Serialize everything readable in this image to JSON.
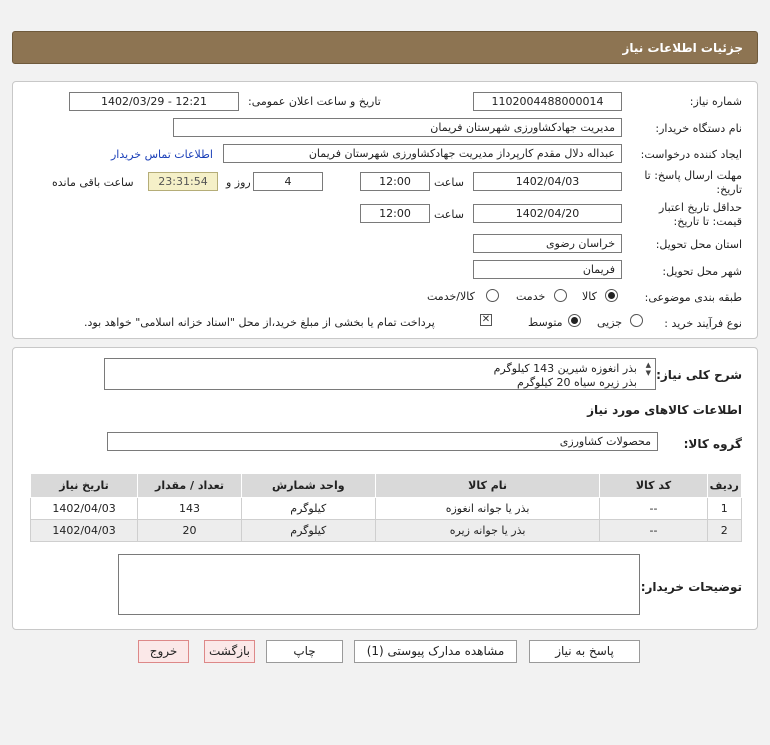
{
  "header": {
    "title": "جزئیات اطلاعات نیاز"
  },
  "form": {
    "need_number": {
      "label": "شماره نیاز:",
      "value": "1102004488000014"
    },
    "announce": {
      "label": "تاریخ و ساعت اعلان عمومی:",
      "value": "1402/03/29 - 12:21"
    },
    "buyer_org": {
      "label": "نام دستگاه خریدار:",
      "value": "مدیریت جهادکشاورزی شهرستان فریمان"
    },
    "creator": {
      "label": "ایجاد کننده درخواست:",
      "value": "عبداله دلال مقدم کارپرداز مدیریت جهادکشاورزی شهرستان فریمان"
    },
    "contact_link": "اطلاعات تماس خریدار",
    "reply_deadline": {
      "label_line1": "مهلت ارسال پاسخ: تا",
      "label_line2": "تاریخ:",
      "date": "1402/04/03",
      "time_label": "ساعت",
      "time": "12:00",
      "days": "4",
      "days_label": "روز و",
      "remaining": "23:31:54",
      "remaining_label": "ساعت باقی مانده"
    },
    "price_validity": {
      "label_line1": "حداقل تاریخ اعتبار",
      "label_line2": "قیمت: تا تاریخ:",
      "date": "1402/04/20",
      "time_label": "ساعت",
      "time": "12:00"
    },
    "province": {
      "label": "استان محل تحویل:",
      "value": "خراسان رضوی"
    },
    "city": {
      "label": "شهر محل تحویل:",
      "value": "فریمان"
    },
    "category": {
      "label": "طبقه بندی موضوعی:",
      "options": [
        "کالا",
        "خدمت",
        "کالا/خدمت"
      ],
      "selected": "کالا"
    },
    "process": {
      "label": "نوع فرآیند خرید :",
      "options": [
        "جزیی",
        "متوسط"
      ],
      "selected": "متوسط",
      "note": "پرداخت تمام یا بخشی از مبلغ خرید،از محل \"اسناد خزانه اسلامی\" خواهد بود."
    }
  },
  "summary": {
    "label": "شرح کلی نیاز:",
    "line1": "بذر انغوزه شیرین 143 کیلوگرم",
    "line2": "بذر زیره سیاه 20 کیلوگرم"
  },
  "goods_section_title": "اطلاعات کالاهای مورد نیاز",
  "goods_group": {
    "label": "گروه کالا:",
    "value": "محصولات کشاورزی"
  },
  "table": {
    "headers": [
      "ردیف",
      "کد کالا",
      "نام کالا",
      "واحد شمارش",
      "تعداد / مقدار",
      "تاریخ نیاز"
    ],
    "rows": [
      [
        "1",
        "--",
        "بذر یا جوانه انغوزه",
        "کیلوگرم",
        "143",
        "1402/04/03"
      ],
      [
        "2",
        "--",
        "بذر یا جوانه زیره",
        "کیلوگرم",
        "20",
        "1402/04/03"
      ]
    ]
  },
  "buyer_notes": {
    "label": "توضیحات خریدار:",
    "value": ""
  },
  "buttons": {
    "reply": "پاسخ به نیاز",
    "attachments": "مشاهده مدارک پیوستی (1)",
    "print": "چاپ",
    "back": "بازگشت",
    "exit": "خروج"
  }
}
